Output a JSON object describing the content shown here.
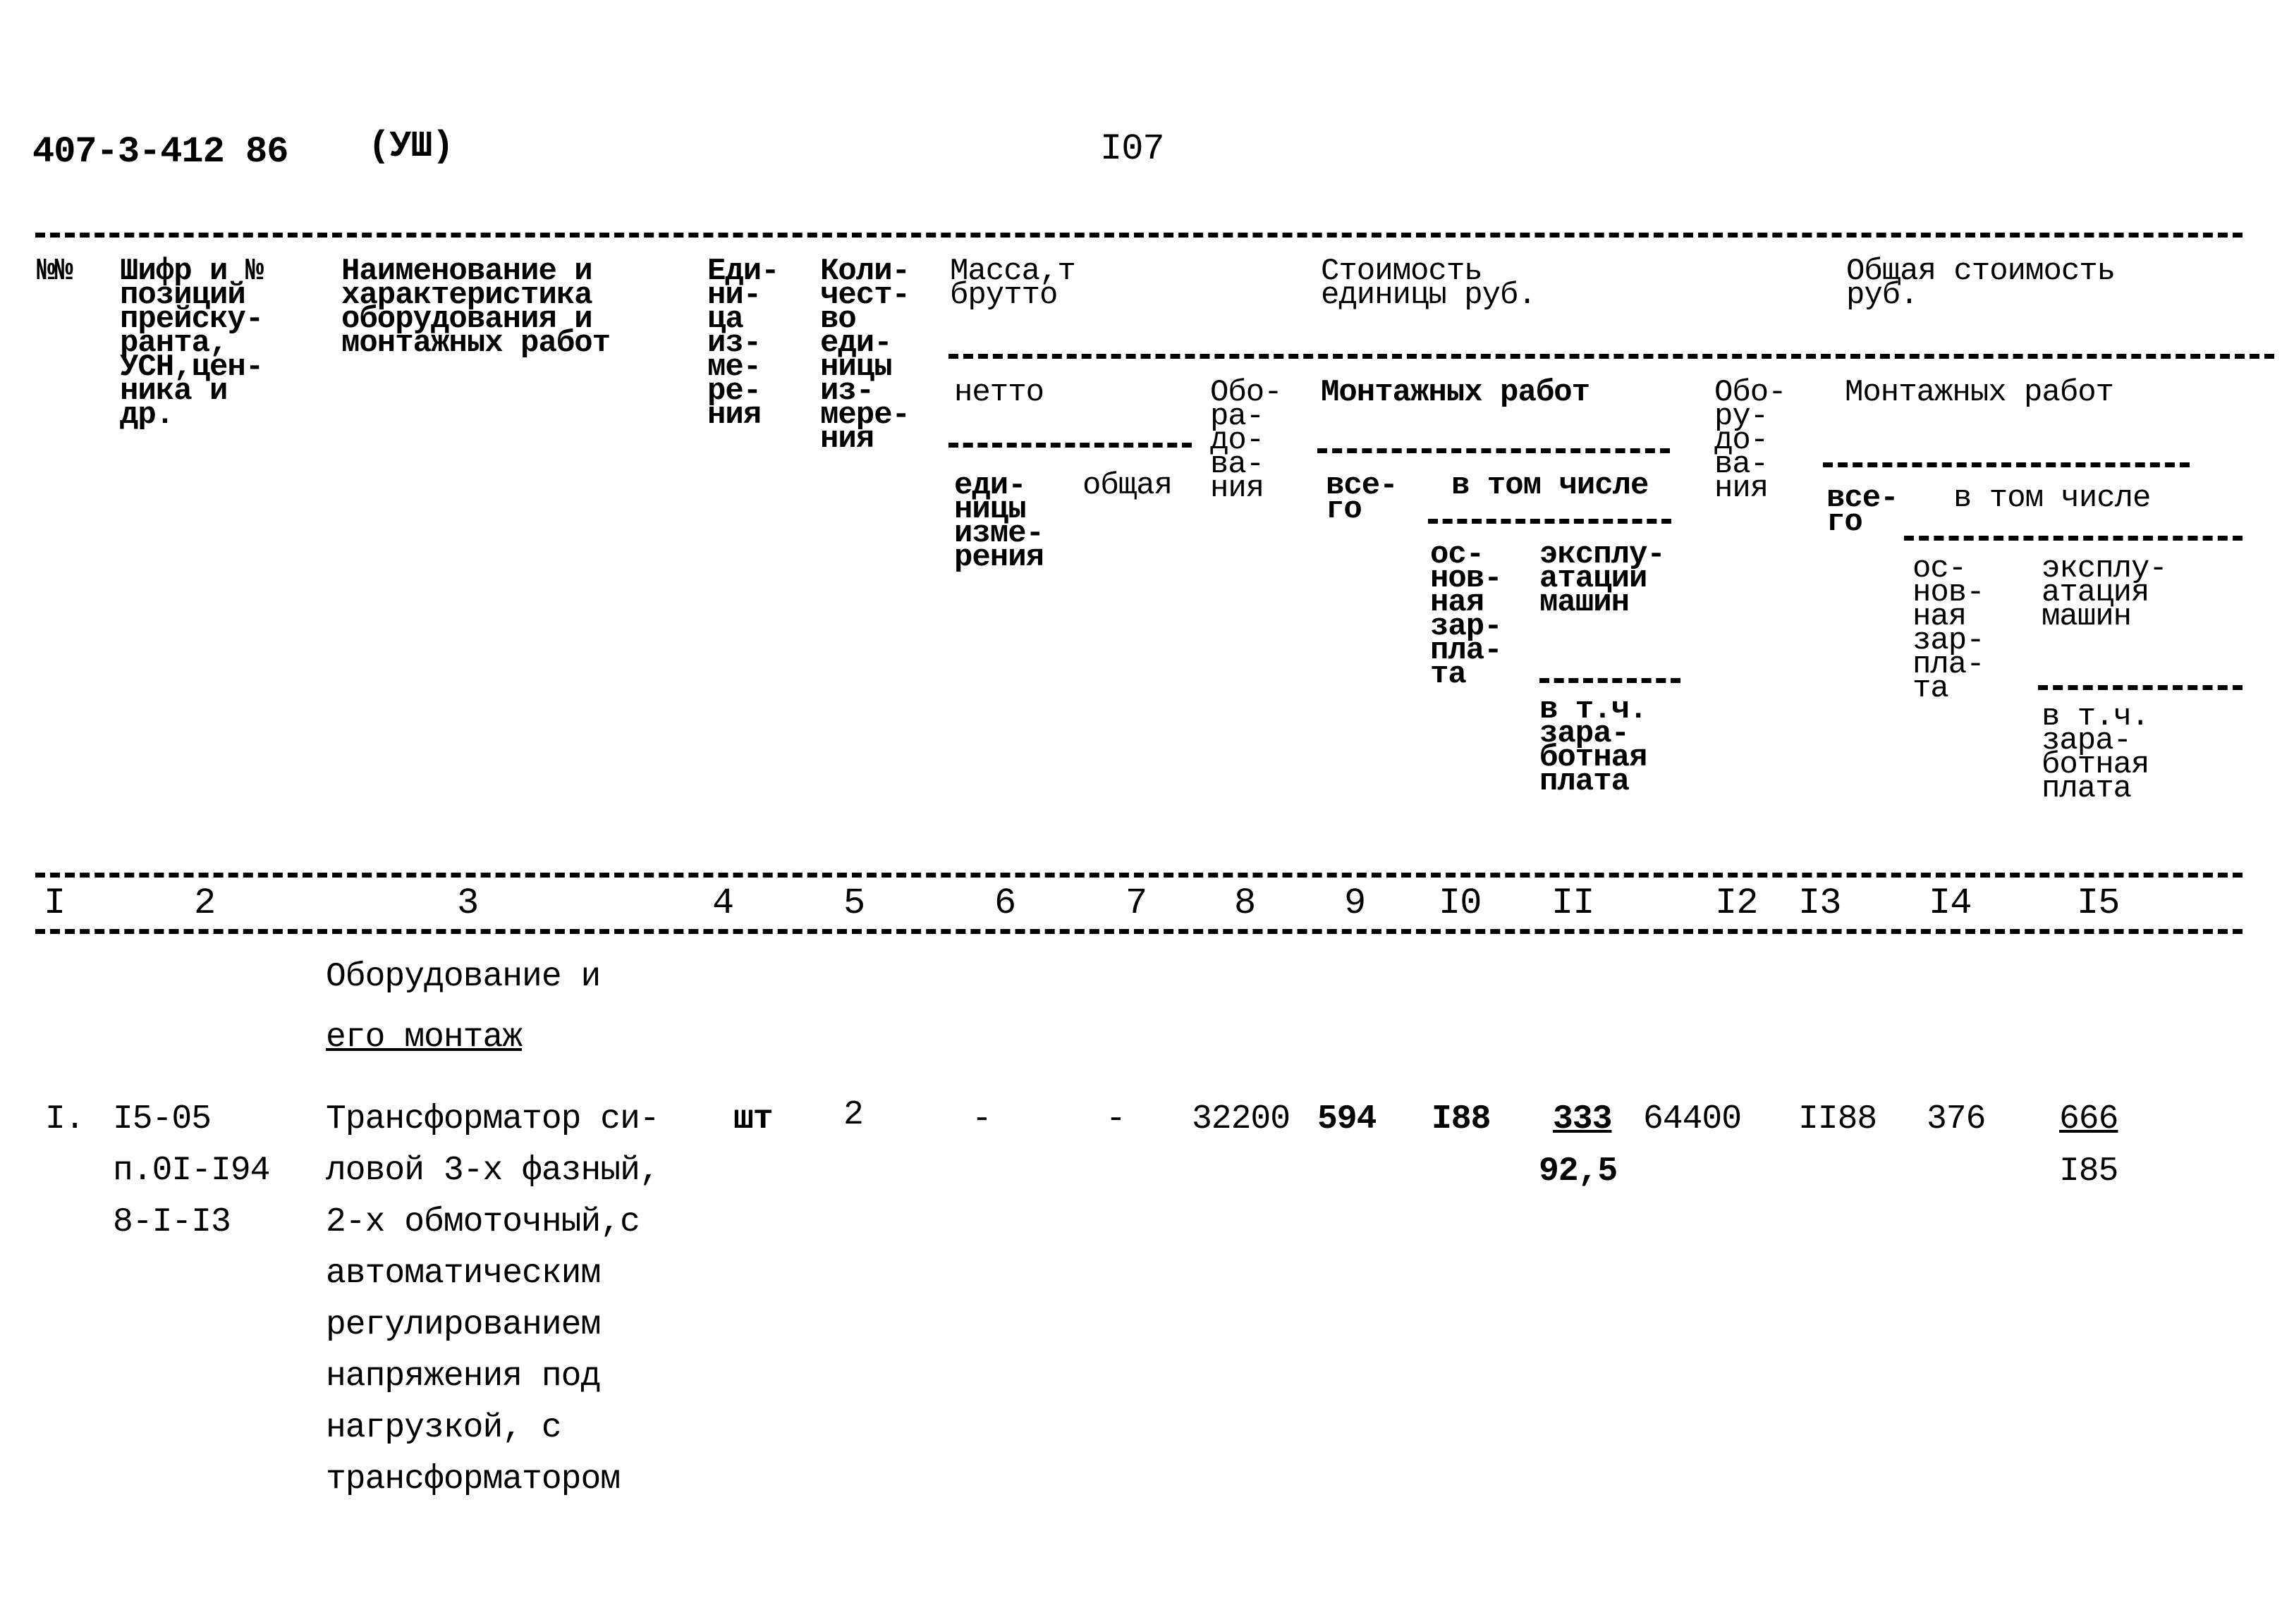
{
  "page_header": {
    "doc_code": "407-3-412 86",
    "section": "(УШ)",
    "page_number": "I07"
  },
  "table_header": {
    "col1": "№№",
    "col2": "Шифр и №\nпозиций\nпрейску-\nранта,\nУСН,цен-\nника и\nдр.",
    "col3": "Наименование и\nхарактеристика\nоборудования и\nмонтажных работ",
    "col4": "Еди-\nни-\nца\nиз-\nме-\nре-\nния",
    "col5": "Коли-\nчест-\nво\nеди-\nницы\nиз-\nмере-\nния",
    "mass_group": "Масса,т\nбрутто",
    "netto": "нетто",
    "col6": "еди-\nницы\nизме-\nрения",
    "col7": "общая",
    "unit_cost_group": "Стоимость\nединицы руб.",
    "col8": "Обо-\nра-\nдо-\nва-\nния",
    "unit_mount_group": "Монтажных работ",
    "col9": "все-\nго",
    "unit_incl": "в том числе",
    "col10": "ос-\nнов-\nная\nзар-\nпла-\nта",
    "col11_top": "эксплу-\nатации\nмашин",
    "col11_bottom": "в т.ч.\nзара-\nботная\nплата",
    "total_cost_group": "Общая стоимость\nруб.",
    "col12": "Обо-\nру-\nдо-\nва-\nния",
    "total_mount_group": "Монтажных работ",
    "col13": "все-\nго",
    "total_incl": "в том числе",
    "col14": "ос-\nнов-\nная\nзар-\nпла-\nта",
    "col15_top": "эксплу-\nатация\nмашин",
    "col15_bottom": "в т.ч.\nзара-\nботная\nплата"
  },
  "column_numbers": [
    "I",
    "2",
    "3",
    "4",
    "5",
    "6",
    "7",
    "8",
    "9",
    "I0",
    "II",
    "I2",
    "I3",
    "I4",
    "I5"
  ],
  "section_title": {
    "line1": "Оборудование и",
    "line2": "его монтаж"
  },
  "rows": [
    {
      "no": "I.",
      "code": "I5-05\nп.0I-I94\n8-I-I3",
      "name": "Трансформатор си-\nловой 3-х фазный,\n2-х обмоточный,с\nавтоматическим\nрегулированием\nнапряжения под\nнагрузкой, с\nтрансформатором",
      "unit": "шт",
      "qty": "2",
      "mass_unit": "-",
      "mass_total": "-",
      "unit_equipment": "32200",
      "unit_mount_total": "594",
      "unit_base_salary": "I88",
      "unit_machine": "333",
      "unit_machine_salary": "92,5",
      "total_equipment": "64400",
      "total_mount_total": "II88",
      "total_base_salary": "376",
      "total_machine": "666",
      "total_machine_salary": "I85"
    }
  ]
}
